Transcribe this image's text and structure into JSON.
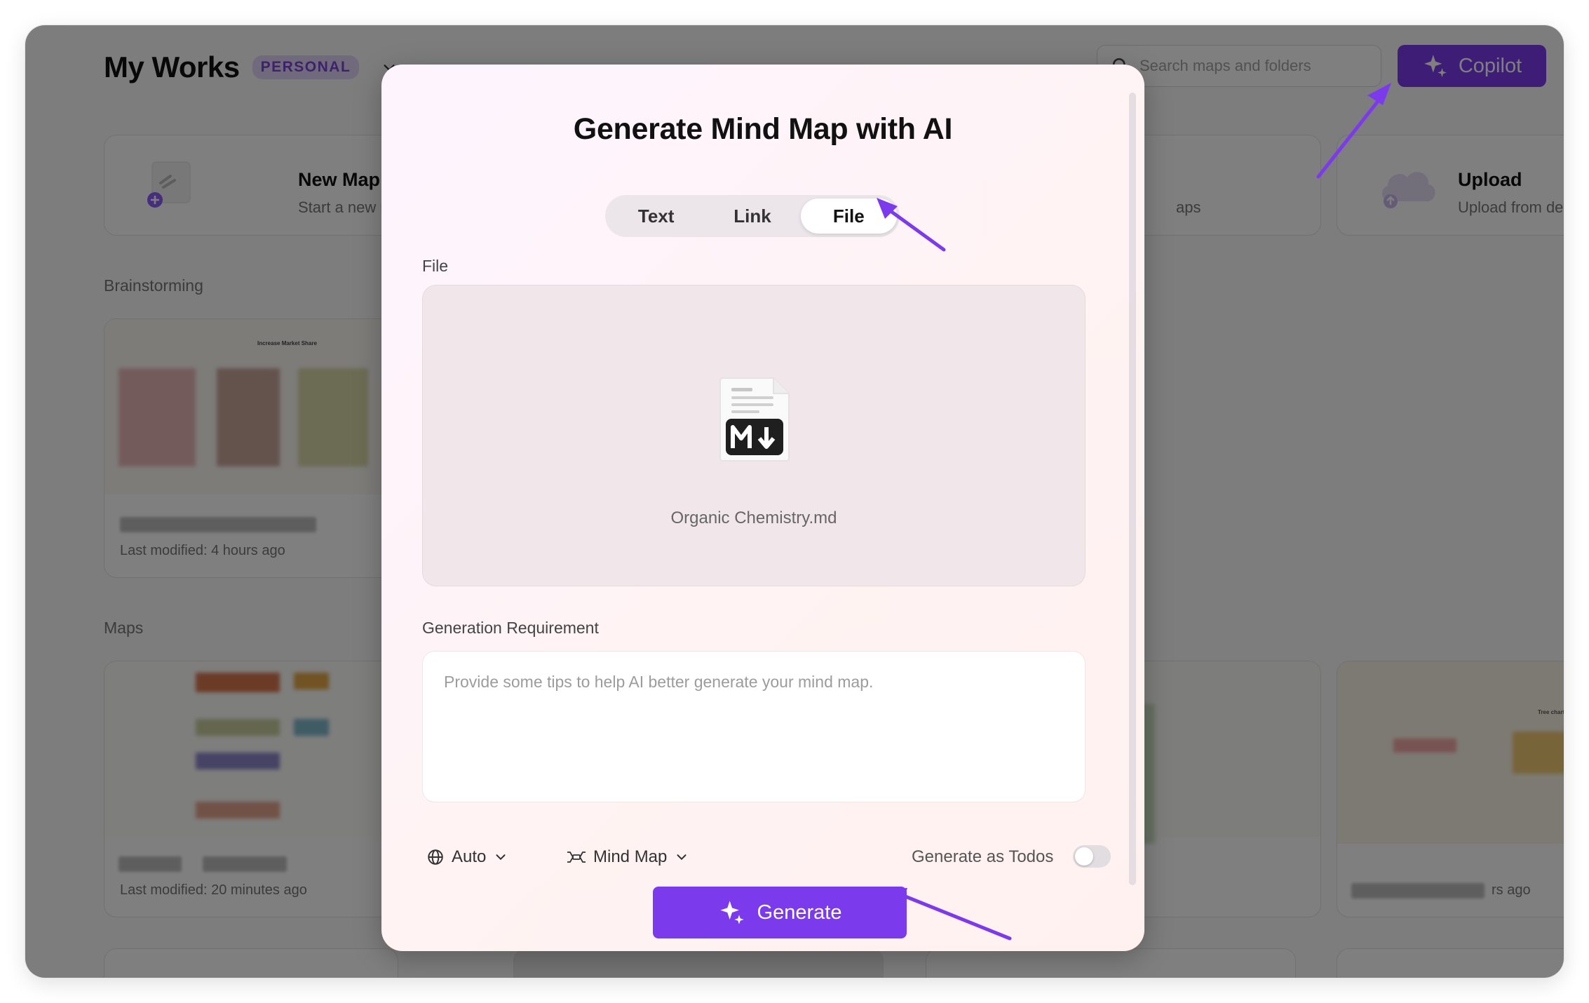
{
  "header": {
    "title": "My Works",
    "workspace_badge": "PERSONAL",
    "search_placeholder": "Search maps and folders",
    "copilot_label": "Copilot"
  },
  "quick_actions": {
    "new_map": {
      "title": "New Map",
      "subtitle": "Start a new map"
    },
    "middle_subtitle": "aps",
    "upload": {
      "title": "Upload",
      "subtitle": "Upload from de"
    }
  },
  "sections": {
    "brainstorming": "Brainstorming",
    "maps": "Maps"
  },
  "cards": {
    "brainstorm_card": {
      "preview_title": "Increase Market Share",
      "modified": "Last modified: 4 hours ago"
    },
    "maps_card_1": {
      "modified": "Last modified: 20 minutes ago"
    },
    "maps_card_4": {
      "modified_fragment": "rs ago",
      "preview_title": "Tree chart"
    }
  },
  "modal": {
    "title": "Generate Mind Map with AI",
    "tabs": [
      "Text",
      "Link",
      "File"
    ],
    "active_tab": "File",
    "file_label": "File",
    "file_name": "Organic Chemistry.md",
    "requirement_label": "Generation Requirement",
    "requirement_placeholder": "Provide some tips to help AI better generate your mind map.",
    "language_option": "Auto",
    "layout_option": "Mind Map",
    "todos_label": "Generate as Todos",
    "todos_enabled": false,
    "generate_label": "Generate"
  },
  "colors": {
    "accent": "#7c3aed",
    "badge_bg": "#e2d4f8",
    "badge_text": "#7a45d6",
    "annotation_arrow": "#7c3aed"
  }
}
